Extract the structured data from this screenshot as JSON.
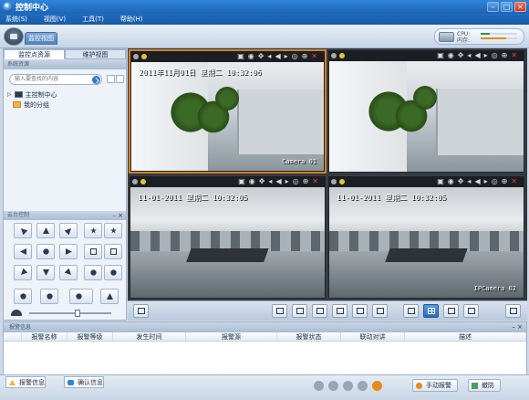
{
  "window": {
    "title": "控制中心"
  },
  "menu": [
    "系统(S)",
    "视图(V)",
    "工具(T)",
    "帮助(H)"
  ],
  "header": {
    "tab_label": "监控视图",
    "cpu_label": "CPU:",
    "mem_label": "内存:"
  },
  "left_panel": {
    "tabs": [
      "监控点资源",
      "维护视图"
    ],
    "section_title": "系统资源",
    "search_placeholder": "输入要查找的内容",
    "tree": [
      "主控制中心",
      "我的分组"
    ],
    "ptz_title": "云台控制"
  },
  "videos": [
    {
      "time": "2011年11月01日 星期二 10:32:06",
      "camera": "Camera 01",
      "scene": "office"
    },
    {
      "time": "",
      "camera": "",
      "scene": "office"
    },
    {
      "time": "11-01-2011 星期二 10:32:05",
      "camera": "",
      "scene": "hall"
    },
    {
      "time": "11-01-2011 星期二 10:32:05",
      "camera": "IPCamera 02",
      "scene": "hall"
    }
  ],
  "alarm": {
    "title": "报警信息",
    "columns": [
      "报警名称",
      "报警等级",
      "发生时间",
      "报警源",
      "报警状态",
      "联动对讲",
      "描述"
    ]
  },
  "status": {
    "tab_alarm": "报警信息",
    "tab_confirm": "确认信息",
    "manual_alarm": "手动报警",
    "defense": "撤防"
  },
  "colors": {
    "title_blue": "#1e63b3",
    "selected_border": "#d87e20",
    "accent_orange": "#e88a1c"
  }
}
